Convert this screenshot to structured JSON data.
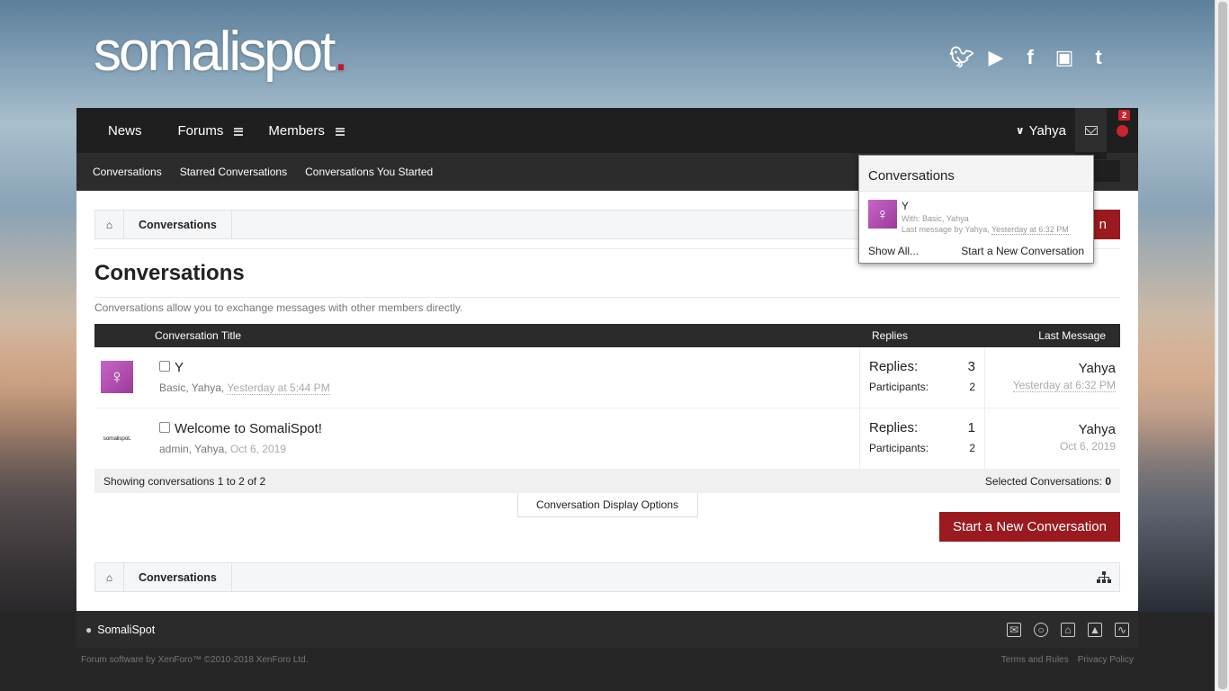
{
  "header": {
    "logo": "somalispot",
    "logo_dot": ".",
    "socials": [
      "twitter-icon",
      "youtube-icon",
      "facebook-icon",
      "instagram-icon",
      "tumblr-icon"
    ]
  },
  "navbar": {
    "tabs": [
      {
        "label": "News"
      },
      {
        "label": "Forums"
      },
      {
        "label": "Members"
      }
    ],
    "user": "Yahya",
    "alerts_badge": "2"
  },
  "subnav": {
    "items": [
      "Conversations",
      "Starred Conversations",
      "Conversations You Started"
    ]
  },
  "breadcrumb": {
    "item": "Conversations"
  },
  "page": {
    "title": "Conversations",
    "description": "Conversations allow you to exchange messages with other members directly.",
    "start_button_partial": "n",
    "start_button": "Start a New Conversation"
  },
  "table": {
    "headers": {
      "title": "Conversation Title",
      "replies": "Replies",
      "last": "Last Message"
    },
    "rows": [
      {
        "title": "Y",
        "participants_text": "Basic, Yahya, ",
        "time": "Yesterday at 5:44 PM",
        "replies_label": "Replies:",
        "replies": "3",
        "participants_label": "Participants:",
        "participants": "2",
        "last_user": "Yahya",
        "last_time": "Yesterday at 6:32 PM"
      },
      {
        "title": "Welcome to SomaliSpot!",
        "participants_text": "admin, Yahya, ",
        "time": "Oct 6, 2019",
        "replies_label": "Replies:",
        "replies": "1",
        "participants_label": "Participants:",
        "participants": "2",
        "last_user": "Yahya",
        "last_time": "Oct 6, 2019"
      }
    ],
    "footer_left": "Showing conversations 1 to 2 of 2",
    "footer_right_label": "Selected Conversations: ",
    "footer_right_value": "0",
    "options_button": "Conversation Display Options"
  },
  "avatar_logo": {
    "text": "somalispot",
    "dot": "."
  },
  "popup": {
    "title": "Conversations",
    "item_title": "Y",
    "item_with": "With: Basic, Yahya",
    "item_last_prefix": "Last message by Yahya, ",
    "item_last_time": "Yesterday at 6:32 PM",
    "show_all": "Show All...",
    "start_new": "Start a New Conversation"
  },
  "footer": {
    "site_name": "SomaliSpot",
    "copyright": "Forum software by XenForo™ ©2010-2018 XenForo Ltd.",
    "links": [
      "Terms and Rules",
      "Privacy Policy"
    ],
    "icons": [
      "mail-icon",
      "help-icon",
      "home-icon",
      "top-icon",
      "rss-icon"
    ]
  },
  "colors": {
    "accent": "#9a1a1f",
    "nav_bg": "#1f1f1f",
    "badge": "#c9232f"
  }
}
